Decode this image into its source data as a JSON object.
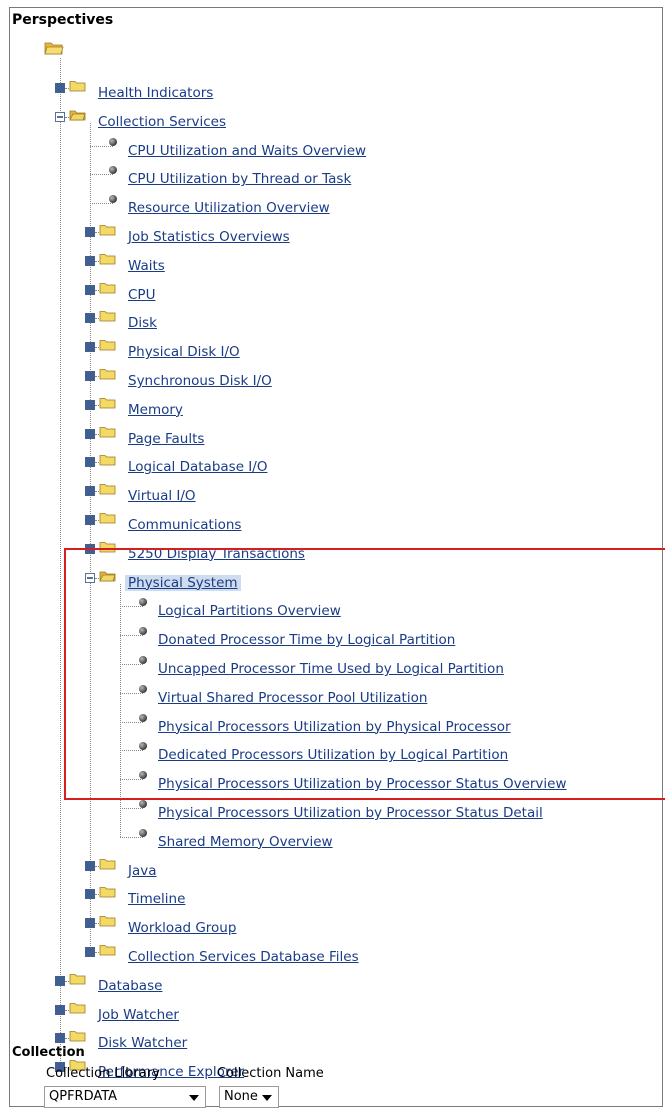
{
  "perspectives": {
    "heading": "Perspectives",
    "items": [
      {
        "label": "Health Indicators",
        "level": 1,
        "kind": "folder",
        "state": "collapsed"
      },
      {
        "label": "Collection Services",
        "level": 1,
        "kind": "folder",
        "state": "expanded"
      },
      {
        "label": "CPU Utilization and Waits Overview",
        "level": 2,
        "kind": "leaf"
      },
      {
        "label": "CPU Utilization by Thread or Task",
        "level": 2,
        "kind": "leaf"
      },
      {
        "label": "Resource Utilization Overview",
        "level": 2,
        "kind": "leaf"
      },
      {
        "label": "Job Statistics Overviews",
        "level": 2,
        "kind": "folder",
        "state": "collapsed"
      },
      {
        "label": "Waits",
        "level": 2,
        "kind": "folder",
        "state": "collapsed"
      },
      {
        "label": "CPU",
        "level": 2,
        "kind": "folder",
        "state": "collapsed"
      },
      {
        "label": "Disk",
        "level": 2,
        "kind": "folder",
        "state": "collapsed"
      },
      {
        "label": "Physical Disk I/O",
        "level": 2,
        "kind": "folder",
        "state": "collapsed"
      },
      {
        "label": "Synchronous Disk I/O",
        "level": 2,
        "kind": "folder",
        "state": "collapsed"
      },
      {
        "label": "Memory",
        "level": 2,
        "kind": "folder",
        "state": "collapsed"
      },
      {
        "label": "Page Faults",
        "level": 2,
        "kind": "folder",
        "state": "collapsed"
      },
      {
        "label": "Logical Database I/O",
        "level": 2,
        "kind": "folder",
        "state": "collapsed"
      },
      {
        "label": "Virtual I/O",
        "level": 2,
        "kind": "folder",
        "state": "collapsed"
      },
      {
        "label": "Communications",
        "level": 2,
        "kind": "folder",
        "state": "collapsed"
      },
      {
        "label": "5250 Display Transactions",
        "level": 2,
        "kind": "folder",
        "state": "collapsed"
      },
      {
        "label": "Physical System",
        "level": 2,
        "kind": "folder",
        "state": "expanded",
        "selected": true
      },
      {
        "label": "Logical Partitions Overview",
        "level": 3,
        "kind": "leaf"
      },
      {
        "label": "Donated Processor Time by Logical Partition",
        "level": 3,
        "kind": "leaf"
      },
      {
        "label": "Uncapped Processor Time Used by Logical Partition",
        "level": 3,
        "kind": "leaf"
      },
      {
        "label": "Virtual Shared Processor Pool Utilization",
        "level": 3,
        "kind": "leaf"
      },
      {
        "label": "Physical Processors Utilization by Physical Processor",
        "level": 3,
        "kind": "leaf"
      },
      {
        "label": "Dedicated Processors Utilization by Logical Partition",
        "level": 3,
        "kind": "leaf"
      },
      {
        "label": "Physical Processors Utilization by Processor Status Overview",
        "level": 3,
        "kind": "leaf"
      },
      {
        "label": "Physical Processors Utilization by Processor Status Detail",
        "level": 3,
        "kind": "leaf"
      },
      {
        "label": "Shared Memory Overview",
        "level": 3,
        "kind": "leaf"
      },
      {
        "label": "Java",
        "level": 2,
        "kind": "folder",
        "state": "collapsed"
      },
      {
        "label": "Timeline",
        "level": 2,
        "kind": "folder",
        "state": "collapsed"
      },
      {
        "label": "Workload Group",
        "level": 2,
        "kind": "folder",
        "state": "collapsed"
      },
      {
        "label": "Collection Services Database Files",
        "level": 2,
        "kind": "folder",
        "state": "collapsed"
      },
      {
        "label": "Database",
        "level": 1,
        "kind": "folder",
        "state": "collapsed"
      },
      {
        "label": "Job Watcher",
        "level": 1,
        "kind": "folder",
        "state": "collapsed"
      },
      {
        "label": "Disk Watcher",
        "level": 1,
        "kind": "folder",
        "state": "collapsed"
      },
      {
        "label": "Performance Explorer",
        "level": 1,
        "kind": "folder",
        "state": "collapsed"
      }
    ]
  },
  "collection": {
    "heading": "Collection",
    "library_label": "Collection Library",
    "library_value": "QPFRDATA",
    "name_label": "Collection Name",
    "name_value": "None"
  },
  "colors": {
    "link": "#1a3c86",
    "highlight_border": "#d61e1e",
    "selected_bg": "#cfdcee",
    "expander": "#3f5f92",
    "folder": "#f2d35c"
  },
  "icons": {
    "root": "open-folder-icon",
    "folder_closed": "folder-icon",
    "folder_open": "open-folder-icon",
    "leaf": "bullet-icon",
    "expand": "plus-box-icon",
    "collapse": "minus-box-icon",
    "dropdown": "chevron-down-icon"
  }
}
